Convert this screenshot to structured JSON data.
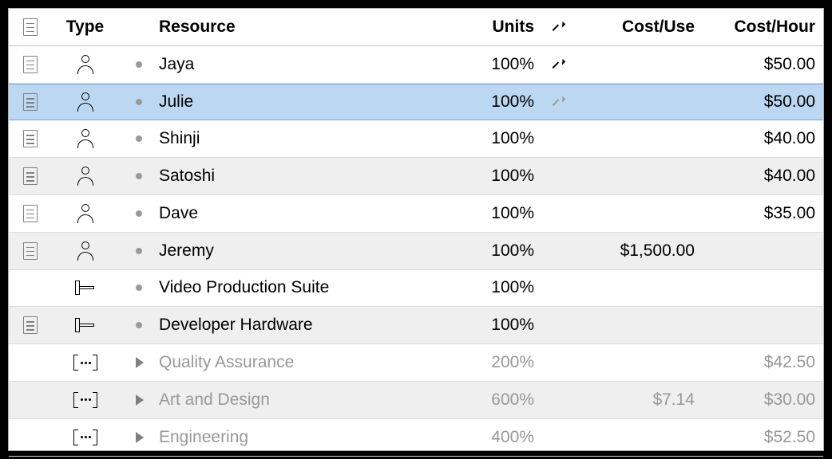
{
  "columns": {
    "note": "",
    "type": "Type",
    "resource": "Resource",
    "units": "Units",
    "share": "↗",
    "costUse": "Cost/Use",
    "costHour": "Cost/Hour"
  },
  "rows": [
    {
      "note": true,
      "icon": "person",
      "bullet": "dot",
      "name": "Jaya",
      "units": "100%",
      "share": "arrow",
      "costUse": "",
      "costHour": "$50.00",
      "zebra": false,
      "selected": false,
      "group": false
    },
    {
      "note": true,
      "icon": "person",
      "bullet": "dot",
      "name": "Julie",
      "units": "100%",
      "share": "arrow-dim",
      "costUse": "",
      "costHour": "$50.00",
      "zebra": false,
      "selected": true,
      "group": false
    },
    {
      "note": true,
      "icon": "person",
      "bullet": "dot",
      "name": "Shinji",
      "units": "100%",
      "share": "",
      "costUse": "",
      "costHour": "$40.00",
      "zebra": false,
      "selected": false,
      "group": false
    },
    {
      "note": true,
      "icon": "person",
      "bullet": "dot",
      "name": "Satoshi",
      "units": "100%",
      "share": "",
      "costUse": "",
      "costHour": "$40.00",
      "zebra": true,
      "selected": false,
      "group": false
    },
    {
      "note": true,
      "icon": "person",
      "bullet": "dot",
      "name": "Dave",
      "units": "100%",
      "share": "",
      "costUse": "",
      "costHour": "$35.00",
      "zebra": false,
      "selected": false,
      "group": false
    },
    {
      "note": true,
      "icon": "person",
      "bullet": "dot",
      "name": "Jeremy",
      "units": "100%",
      "share": "",
      "costUse": "$1,500.00",
      "costHour": "",
      "zebra": true,
      "selected": false,
      "group": false
    },
    {
      "note": false,
      "icon": "equip",
      "bullet": "dot",
      "name": "Video Production Suite",
      "units": "100%",
      "share": "",
      "costUse": "",
      "costHour": "",
      "zebra": false,
      "selected": false,
      "group": false
    },
    {
      "note": true,
      "icon": "equip",
      "bullet": "dot",
      "name": "Developer Hardware",
      "units": "100%",
      "share": "",
      "costUse": "",
      "costHour": "",
      "zebra": true,
      "selected": false,
      "group": false
    },
    {
      "note": false,
      "icon": "group",
      "bullet": "disclosure",
      "name": "Quality Assurance",
      "units": "200%",
      "share": "",
      "costUse": "",
      "costHour": "$42.50",
      "zebra": false,
      "selected": false,
      "group": true
    },
    {
      "note": false,
      "icon": "group",
      "bullet": "disclosure",
      "name": "Art and Design",
      "units": "600%",
      "share": "",
      "costUse": "$7.14",
      "costHour": "$30.00",
      "zebra": true,
      "selected": false,
      "group": true
    },
    {
      "note": false,
      "icon": "group",
      "bullet": "disclosure",
      "name": "Engineering",
      "units": "400%",
      "share": "",
      "costUse": "",
      "costHour": "$52.50",
      "zebra": false,
      "selected": false,
      "group": true
    }
  ]
}
